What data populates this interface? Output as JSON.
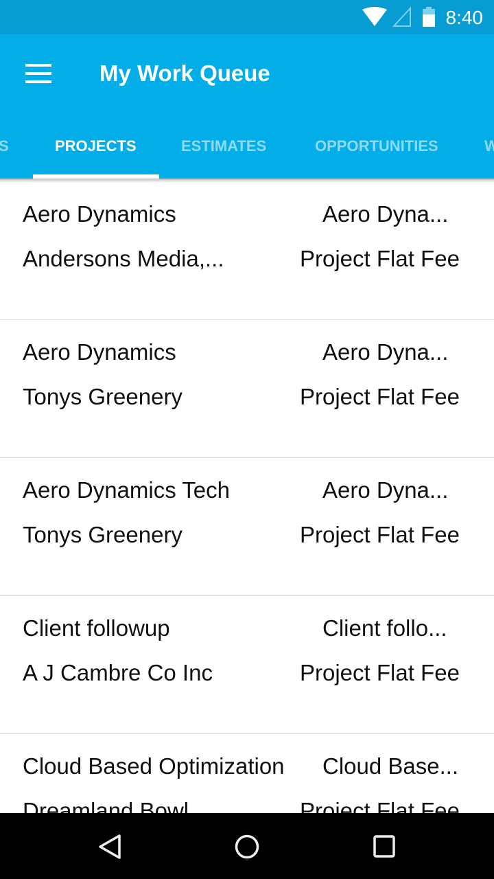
{
  "status_bar": {
    "time": "8:40",
    "icons": [
      "wifi-icon",
      "cell-signal-icon",
      "battery-icon"
    ]
  },
  "app_bar": {
    "title": "My Work Queue",
    "menu_icon": "hamburger-menu-icon"
  },
  "tabs": [
    {
      "label": "S"
    },
    {
      "label": "PROJECTS",
      "active": true
    },
    {
      "label": "ESTIMATES"
    },
    {
      "label": "OPPORTUNITIES"
    },
    {
      "label": "W"
    }
  ],
  "items": [
    {
      "title": "Aero Dynamics",
      "client": "Andersons Media,...",
      "right_title": "Aero Dyna...",
      "type": "Project Flat Fee"
    },
    {
      "title": "Aero Dynamics",
      "client": "Tonys Greenery",
      "right_title": "Aero Dyna...",
      "type": "Project Flat Fee"
    },
    {
      "title": "Aero Dynamics Tech",
      "client": "Tonys Greenery",
      "right_title": "Aero Dyna...",
      "type": "Project Flat Fee"
    },
    {
      "title": "Client followup",
      "client": "A J Cambre Co Inc",
      "right_title": "Client follo...",
      "type": "Project Flat Fee"
    },
    {
      "title": "Cloud Based Optimization",
      "client": "Dreamland Bowl",
      "right_title": "Cloud Base...",
      "type": "Project Flat Fee"
    }
  ],
  "nav_bar": {
    "icons": [
      "back-icon",
      "home-icon",
      "recents-icon"
    ]
  },
  "colors": {
    "status": "#079dd2",
    "app_bar": "#03aee8",
    "tab_inactive": "#8fdaf5"
  }
}
